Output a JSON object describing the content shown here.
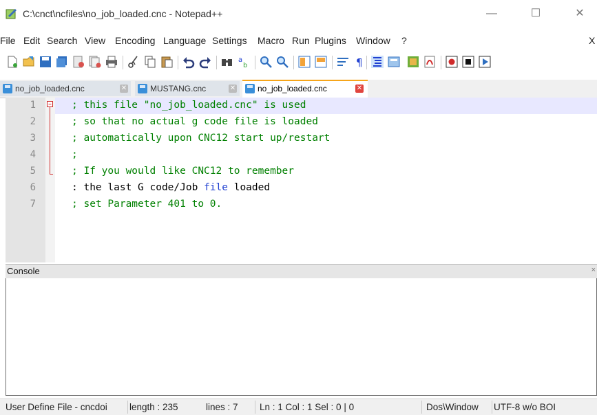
{
  "window": {
    "title": "C:\\cnct\\ncfiles\\no_job_loaded.cnc - Notepad++",
    "minimize_glyph": "—",
    "maximize_glyph": "☐",
    "close_glyph": "✕"
  },
  "menu": {
    "items": [
      "File",
      "Edit",
      "Search",
      "View",
      "Encoding",
      "Language",
      "Settings",
      "Macro",
      "Run",
      "Plugins",
      "Window",
      "?"
    ],
    "close_x": "X"
  },
  "toolbar": {
    "icons": [
      "new-file-icon",
      "open-file-icon",
      "save-icon",
      "save-all-icon",
      "close-icon",
      "close-all-icon",
      "print-icon",
      "cut-icon",
      "copy-icon",
      "paste-icon",
      "undo-icon",
      "redo-icon",
      "find-icon",
      "replace-icon",
      "zoom-in-icon",
      "zoom-out-icon",
      "sync-vertical-icon",
      "sync-horizontal-icon",
      "word-wrap-icon",
      "show-all-chars-icon",
      "indent-guide-icon",
      "document-map-icon",
      "function-list-icon",
      "folder-workspace-icon",
      "record-macro-icon",
      "stop-macro-icon",
      "play-macro-icon"
    ]
  },
  "tabs": [
    {
      "label": "no_job_loaded.cnc",
      "active": false
    },
    {
      "label": "MUSTANG.cnc",
      "active": false
    },
    {
      "label": "no_job_loaded.cnc",
      "active": true
    }
  ],
  "editor": {
    "lines": [
      {
        "num": "1",
        "segments": [
          {
            "t": "; this file \"no_job_loaded.cnc\" is used",
            "c": "comment"
          }
        ]
      },
      {
        "num": "2",
        "segments": [
          {
            "t": "; so that no actual g code file is loaded",
            "c": "comment"
          }
        ]
      },
      {
        "num": "3",
        "segments": [
          {
            "t": "; automatically upon CNC12 start up/restart",
            "c": "comment"
          }
        ]
      },
      {
        "num": "4",
        "segments": [
          {
            "t": ";",
            "c": "comment"
          }
        ]
      },
      {
        "num": "5",
        "segments": [
          {
            "t": "; If you would like CNC12 to remember",
            "c": "comment"
          }
        ]
      },
      {
        "num": "6",
        "segments": [
          {
            "t": ": the last G code/Job ",
            "c": "text"
          },
          {
            "t": "file",
            "c": "kw"
          },
          {
            "t": " loaded",
            "c": "text"
          }
        ]
      },
      {
        "num": "7",
        "segments": [
          {
            "t": "; set Parameter 401 to 0.",
            "c": "comment"
          }
        ]
      }
    ]
  },
  "console": {
    "label": "Console",
    "corner_mark": "×"
  },
  "status": {
    "language": "User Define File - cncdoi",
    "length": "length : 235",
    "lines": "lines : 7",
    "position": "Ln : 1    Col : 1    Sel : 0 | 0",
    "eol": "Dos\\Window",
    "encoding": "UTF-8 w/o BOI"
  },
  "colors": {
    "comment": "#008000",
    "text": "#000000",
    "keyword": "#1f3fd1",
    "active_tab_accent": "#f6a51a",
    "tab_close_active": "#e0443e"
  }
}
